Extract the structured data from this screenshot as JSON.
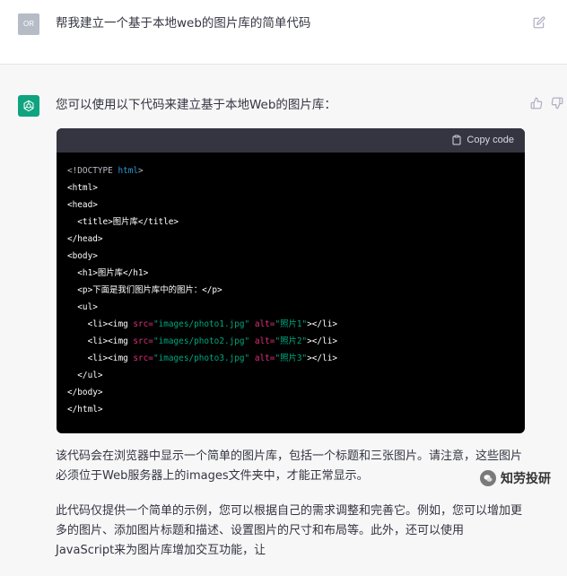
{
  "user": {
    "avatar_initials": "OR",
    "message": "帮我建立一个基于本地web的图片库的简单代码"
  },
  "assistant": {
    "intro": "您可以使用以下代码来建立基于本地Web的图片库：",
    "code_block": {
      "copy_label": "Copy code",
      "lines": [
        [
          "<!DOCTYPE html>"
        ],
        [
          "<html>"
        ],
        [
          "<head>"
        ],
        [
          "  <title>图片库</title>"
        ],
        [
          "</head>"
        ],
        [
          "<body>"
        ],
        [
          "  <h1>图片库</h1>"
        ],
        [
          "  <p>下面是我们图片库中的图片：</p>"
        ],
        [
          "  <ul>"
        ],
        [
          "    <li><img ",
          "src=",
          "\"images/photo1.jpg\"",
          " alt=",
          "\"照片1\"",
          "></li>"
        ],
        [
          "    <li><img ",
          "src=",
          "\"images/photo2.jpg\"",
          " alt=",
          "\"照片2\"",
          "></li>"
        ],
        [
          "    <li><img ",
          "src=",
          "\"images/photo3.jpg\"",
          " alt=",
          "\"照片3\"",
          "></li>"
        ],
        [
          "  </ul>"
        ],
        [
          "</body>"
        ],
        [
          "</html>"
        ]
      ]
    },
    "paragraph_1": "该代码会在浏览器中显示一个简单的图片库，包括一个标题和三张图片。请注意，这些图片必须位于Web服务器上的images文件夹中，才能正常显示。",
    "paragraph_2": "此代码仅提供一个简单的示例，您可以根据自己的需求调整和完善它。例如，您可以增加更多的图片、添加图片标题和描述、设置图片的尺寸和布局等。此外，还可以使用JavaScript来为图片库增加交互功能，让"
  },
  "watermark": {
    "text": "知劳投研"
  },
  "colors": {
    "bot_avatar": "#10a37f",
    "code_bg": "#000000",
    "code_header_bg": "#343541",
    "keyword": "#2e95d3",
    "attribute": "#df3079",
    "string": "#00a67d"
  }
}
